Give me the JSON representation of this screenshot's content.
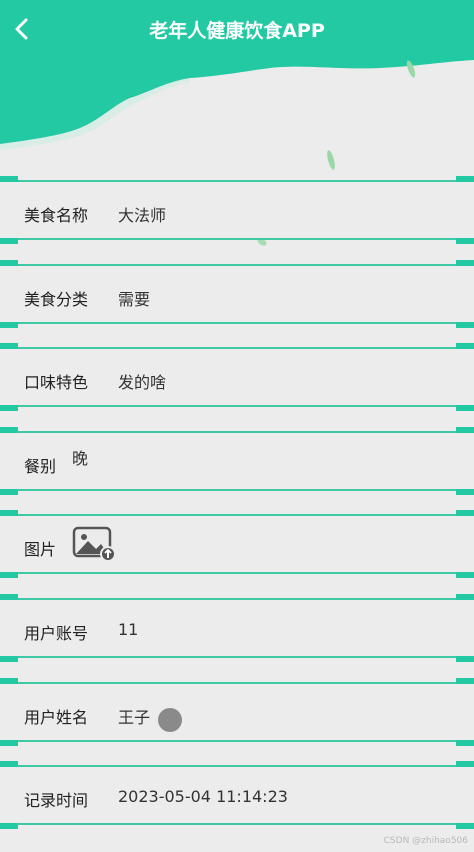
{
  "header": {
    "title": "老年人健康饮食APP"
  },
  "fields": [
    {
      "label": "美食名称",
      "value": "大法师"
    },
    {
      "label": "美食分类",
      "value": "需要"
    },
    {
      "label": "口味特色",
      "value": "发的啥"
    },
    {
      "label": "餐别",
      "value": "晚"
    },
    {
      "label": "图片",
      "value": ""
    },
    {
      "label": "用户账号",
      "value": "11"
    },
    {
      "label": "用户姓名",
      "value": "王子"
    },
    {
      "label": "记录时间",
      "value": "2023-05-04 11:14:23"
    }
  ],
  "colors": {
    "accent": "#22c9a2",
    "border": "#3ec9a4",
    "background": "#ececec"
  },
  "icons": {
    "back": "chevron-left-icon",
    "image_placeholder": "image-upload-icon"
  },
  "watermark": "CSDN @zhihao506"
}
